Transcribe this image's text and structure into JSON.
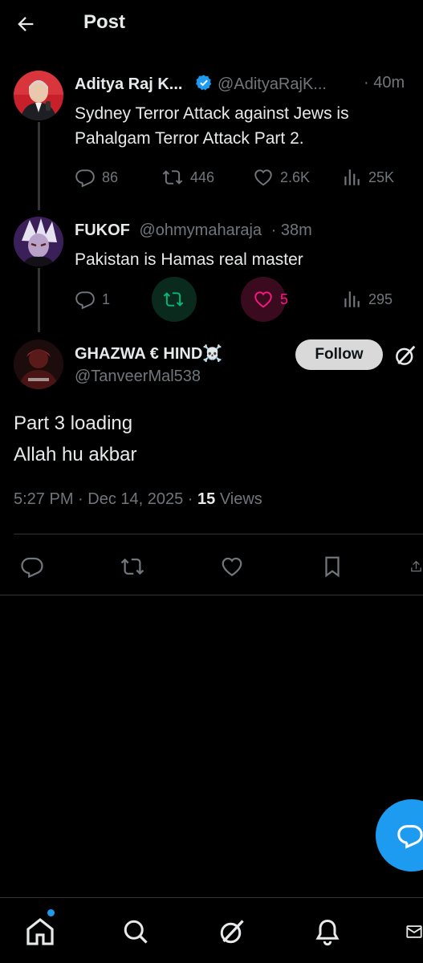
{
  "header": {
    "title": "Post"
  },
  "thread": [
    {
      "display_name": "Aditya Raj K...",
      "handle": "@AdityaRajK...",
      "time": "· 40m",
      "verified": true,
      "text_lines": [
        "Sydney Terror Attack against Jews is",
        "Pahalgam Terror Attack Part 2."
      ],
      "replies": "86",
      "reposts": "446",
      "likes": "2.6K",
      "views": "25K"
    },
    {
      "display_name": "FUKOF",
      "handle": "@ohmymaharaja",
      "time": "· 38m",
      "verified": false,
      "text_lines": [
        "Pakistan is Hamas real master"
      ],
      "replies": "1",
      "reposts": "",
      "likes": "5",
      "views": "295",
      "liked": true,
      "reposted_highlight": true
    }
  ],
  "main_post": {
    "display_name": "GHAZWA € HIND☠️",
    "handle": "@TanveerMal538",
    "follow_label": "Follow",
    "text_lines": [
      "Part 3 loading",
      "Allah hu akbar"
    ],
    "meta_time": "5:27 PM · Dec 14, 2025 · ",
    "views_count": "15",
    "views_label": " Views"
  },
  "colors": {
    "background": "#000000",
    "text": "#e7e9ea",
    "muted": "#71767b",
    "accent": "#1d9bf0",
    "like": "#f91880",
    "repost": "#00ba7c"
  },
  "icons": {
    "header": "arrow-left-icon",
    "actions": [
      "reply-icon",
      "repost-icon",
      "like-icon",
      "views-icon",
      "bookmark-icon",
      "share-icon"
    ],
    "nav": [
      "home-icon",
      "search-icon",
      "grok-icon",
      "bell-icon",
      "mail-icon"
    ],
    "fab": "compose-reply-icon"
  }
}
